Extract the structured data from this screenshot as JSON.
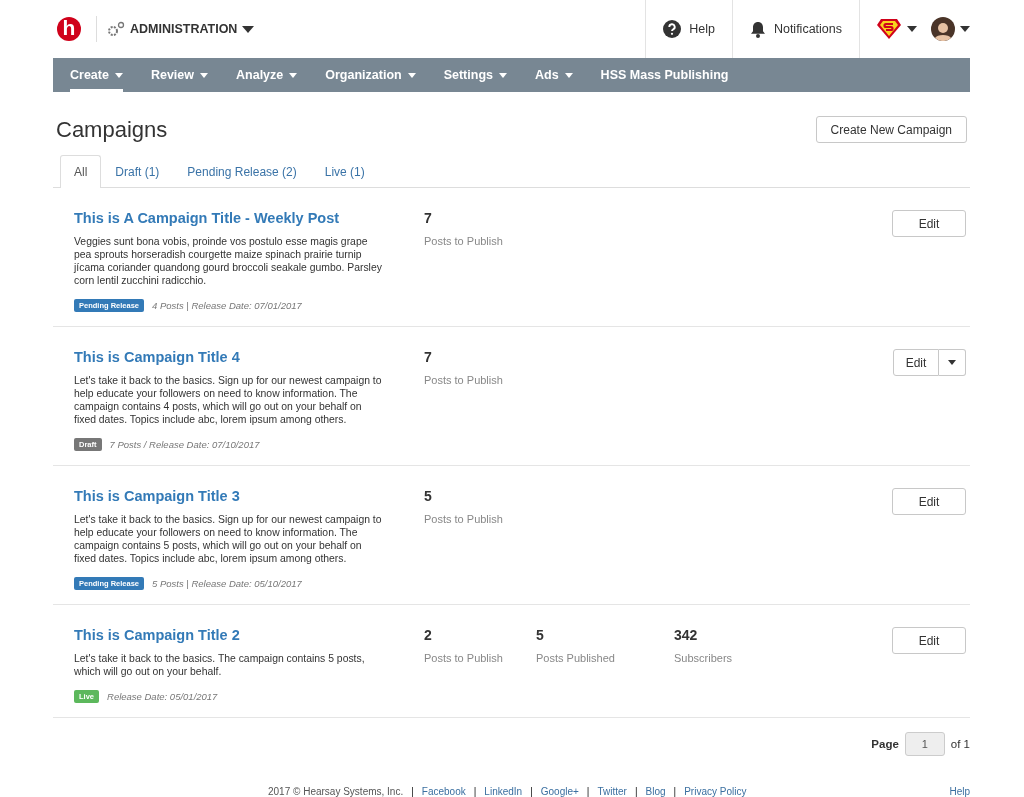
{
  "header": {
    "logo_letter": "h",
    "context": {
      "label": "ADMINISTRATION",
      "dropdown": true
    },
    "utilities": [
      {
        "kind": "help",
        "label": "Help"
      },
      {
        "kind": "bell",
        "label": "Notifications"
      }
    ],
    "account": [
      {
        "kind": "shield",
        "dropdown": true
      },
      {
        "kind": "avatar",
        "dropdown": true
      }
    ]
  },
  "nav": [
    {
      "label": "Create",
      "dropdown": true,
      "selected": true
    },
    {
      "label": "Review",
      "dropdown": true,
      "selected": false
    },
    {
      "label": "Analyze",
      "dropdown": true,
      "selected": false
    },
    {
      "label": "Organization",
      "dropdown": true,
      "selected": false
    },
    {
      "label": "Settings",
      "dropdown": true,
      "selected": false
    },
    {
      "label": "Ads",
      "dropdown": true,
      "selected": false
    },
    {
      "label": "HSS Mass Publishing",
      "dropdown": false,
      "selected": false
    }
  ],
  "page": {
    "title": "Campaigns",
    "create_button": "Create New Campaign"
  },
  "tabs": [
    {
      "label": "All",
      "selected": true
    },
    {
      "label": "Draft (1)",
      "selected": false
    },
    {
      "label": "Pending Release (2)",
      "selected": false
    },
    {
      "label": "Live (1)",
      "selected": false
    }
  ],
  "campaigns": [
    {
      "title": "This is A Campaign Title - Weekly Post",
      "description": "Veggies sunt bona vobis, proinde vos postulo esse magis grape pea sprouts horseradish courgette maize spinach prairie turnip jícama coriander quandong gourd broccoli seakale gumbo. Parsley corn lentil zucchini radicchio.",
      "status": {
        "kind": "pending",
        "label": "Pending Release"
      },
      "meta": "4 Posts | Release Date: 07/01/2017",
      "stats": [
        {
          "value": "7",
          "label": "Posts to Publish"
        }
      ],
      "edit": {
        "label": "Edit",
        "split": false
      }
    },
    {
      "title": "This is Campaign Title 4",
      "description": "Let's take it back to the basics. Sign up for our newest campaign to help educate your followers on need to know information. The campaign contains 4 posts, which will go out on your behalf on fixed dates. Topics include abc, lorem ipsum among others.",
      "status": {
        "kind": "draft",
        "label": "Draft"
      },
      "meta": "7 Posts / Release Date: 07/10/2017",
      "stats": [
        {
          "value": "7",
          "label": "Posts to Publish"
        }
      ],
      "edit": {
        "label": "Edit",
        "split": true
      }
    },
    {
      "title": "This is Campaign Title 3",
      "description": "Let's take it back to the basics. Sign up for our newest campaign to help educate your followers on need to know information. The campaign contains 5 posts, which will go out on your behalf on fixed dates. Topics include abc, lorem ipsum among others.",
      "status": {
        "kind": "pending",
        "label": "Pending Release"
      },
      "meta": "5 Posts | Release Date: 05/10/2017",
      "stats": [
        {
          "value": "5",
          "label": "Posts to Publish"
        }
      ],
      "edit": {
        "label": "Edit",
        "split": false
      }
    },
    {
      "title": "This is Campaign Title 2",
      "description": "Let's take it back to the basics. The campaign contains 5 posts, which will go out on your behalf.",
      "status": {
        "kind": "live",
        "label": "Live"
      },
      "meta": "Release Date: 05/01/2017",
      "stats": [
        {
          "value": "2",
          "label": "Posts to Publish"
        },
        {
          "value": "5",
          "label": "Posts Published"
        },
        {
          "value": "342",
          "label": "Subscribers"
        }
      ],
      "edit": {
        "label": "Edit",
        "split": false
      }
    }
  ],
  "pagination": {
    "label": "Page",
    "current": "1",
    "total": "of 1"
  },
  "footer": {
    "items": [
      {
        "kind": "text",
        "text": "2017 © Hearsay Systems, Inc."
      },
      {
        "kind": "separator",
        "text": "|"
      },
      {
        "kind": "link",
        "text": "Facebook"
      },
      {
        "kind": "separator",
        "text": "|"
      },
      {
        "kind": "link",
        "text": "LinkedIn"
      },
      {
        "kind": "separator",
        "text": "|"
      },
      {
        "kind": "link",
        "text": "Google+"
      },
      {
        "kind": "separator",
        "text": "|"
      },
      {
        "kind": "link",
        "text": "Twitter"
      },
      {
        "kind": "separator",
        "text": "|"
      },
      {
        "kind": "link",
        "text": "Blog"
      },
      {
        "kind": "separator",
        "text": "|"
      },
      {
        "kind": "link",
        "text": "Privacy Policy"
      }
    ],
    "help": "Help"
  }
}
